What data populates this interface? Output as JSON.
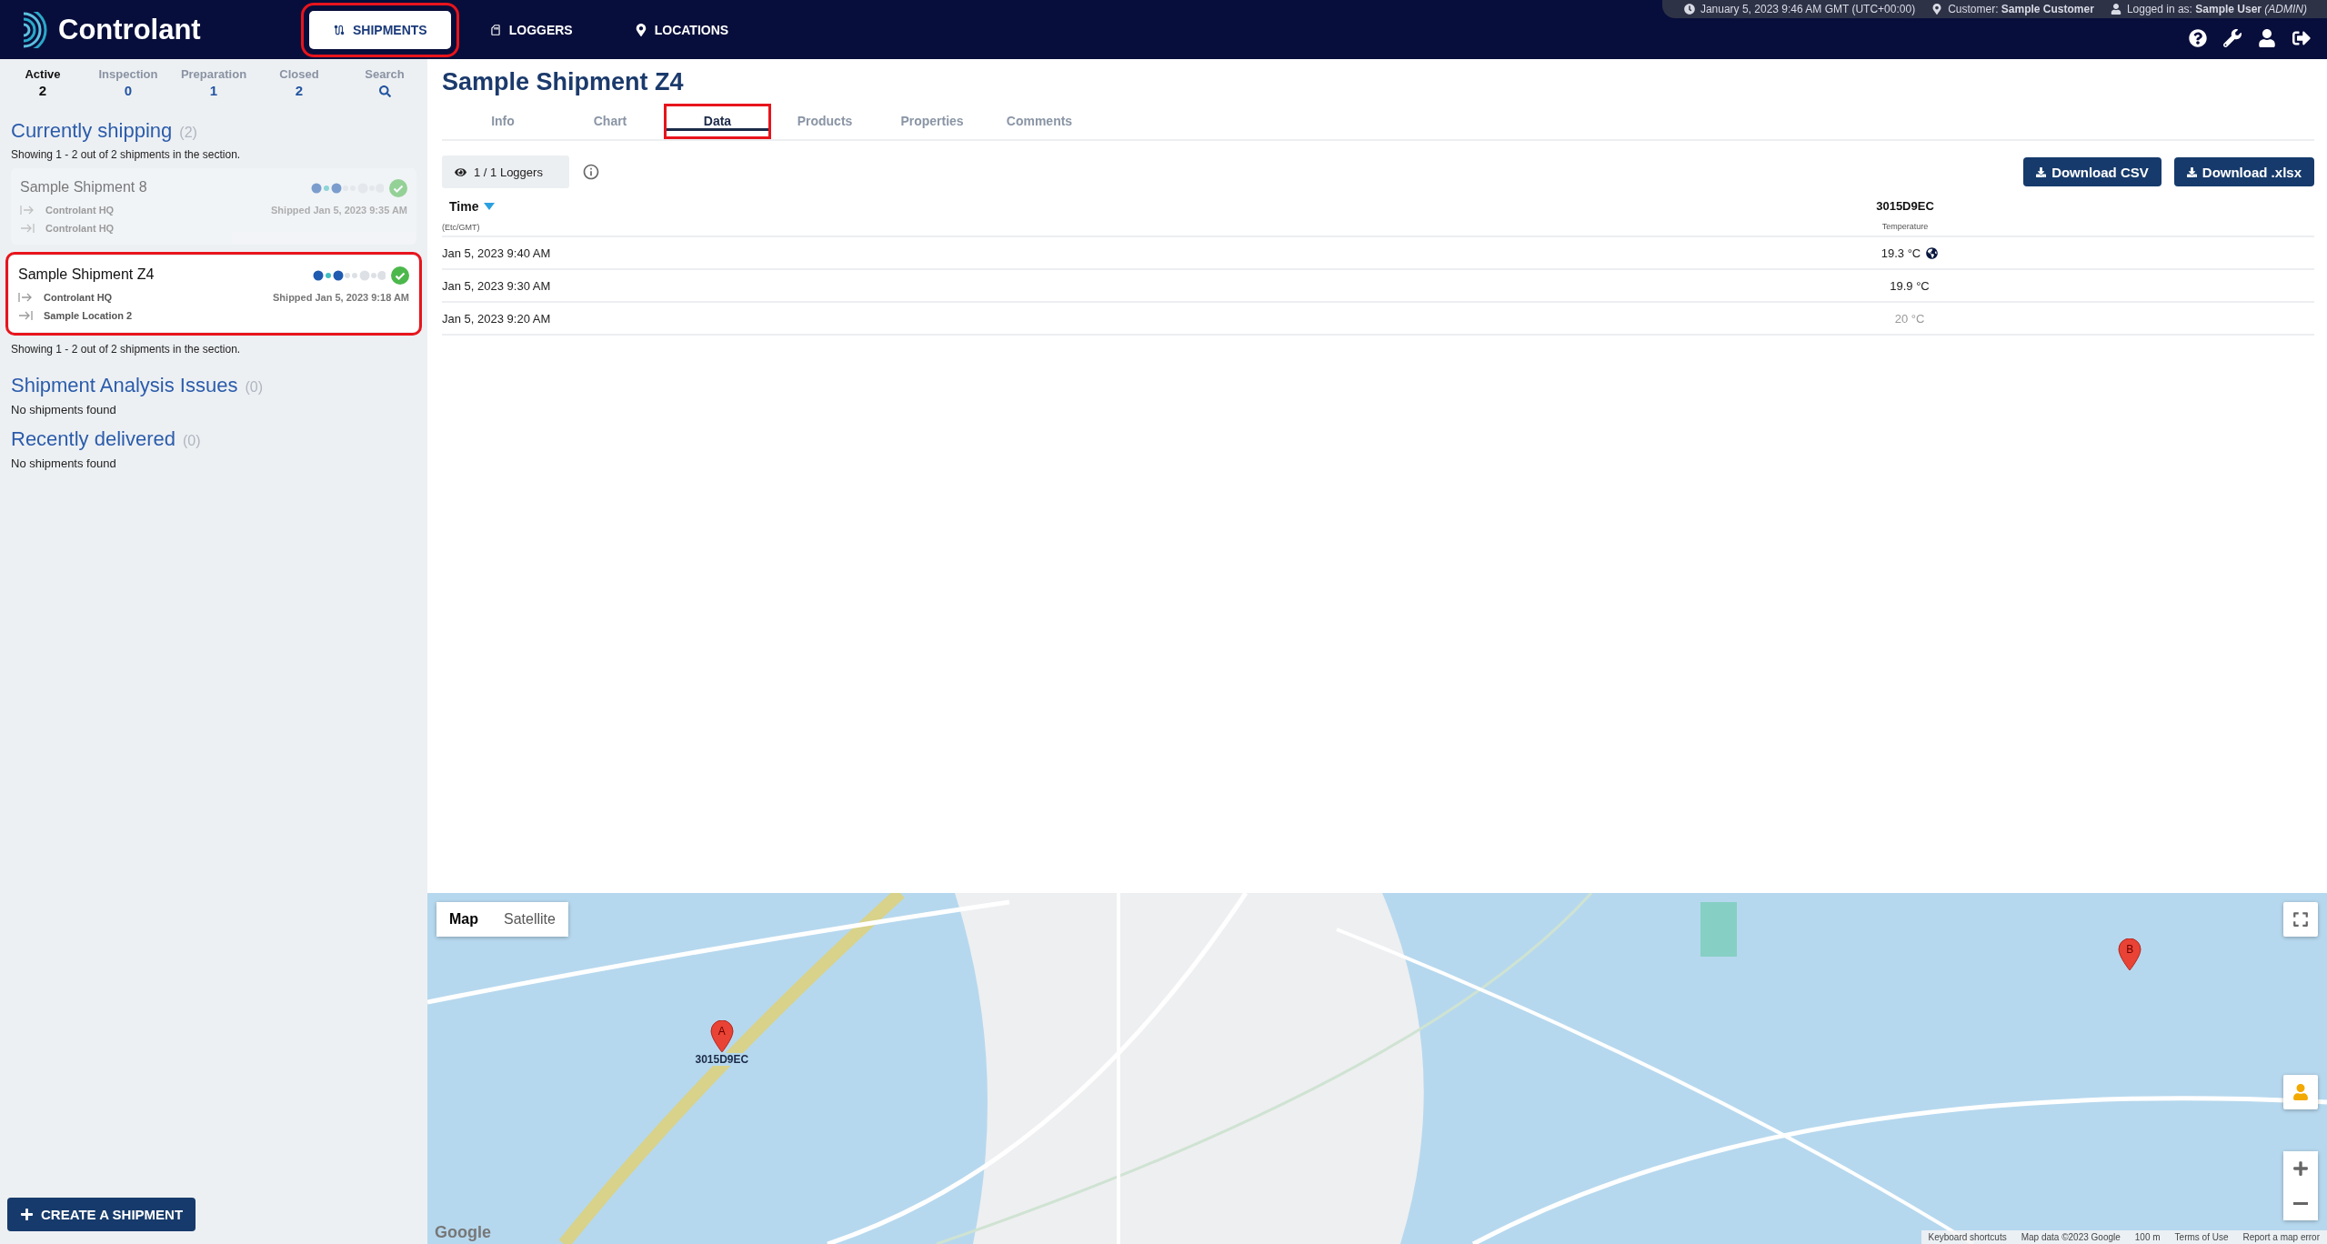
{
  "brand": {
    "name": "Controlant"
  },
  "nav": [
    {
      "label": "SHIPMENTS",
      "kind": "route",
      "selected": true
    },
    {
      "label": "LOGGERS",
      "kind": "logger",
      "selected": false
    },
    {
      "label": "LOCATIONS",
      "kind": "pin",
      "selected": false
    }
  ],
  "info_bar": {
    "datetime": "January 5, 2023 9:46 AM GMT (UTC+00:00)",
    "customer": "Customer: **Sample Customer**",
    "login": "Logged in as: **Sample User** *(ADMIN)*"
  },
  "status_tabs": [
    {
      "kind": "count",
      "label": "Active",
      "count": "2",
      "selected": true
    },
    {
      "kind": "count",
      "label": "Inspection",
      "count": "0",
      "selected": false
    },
    {
      "kind": "count",
      "label": "Preparation",
      "count": "1",
      "selected": false
    },
    {
      "kind": "count",
      "label": "Closed",
      "count": "2",
      "selected": false
    },
    {
      "kind": "search",
      "label": "Search",
      "selected": false
    }
  ],
  "sections": [
    {
      "title": "Currently shipping",
      "count": "(2)",
      "summary": "Showing 1 - 2 out of 2 shipments in the section.",
      "shipments": [
        {
          "name": "Sample Shipment 8",
          "origin": "Controlant HQ",
          "destination": "Controlant HQ",
          "shipped": "Shipped Jan 5, 2023 9:35 AM",
          "selected": false
        },
        {
          "name": "Sample Shipment Z4",
          "origin": "Controlant HQ",
          "destination": "Sample Location 2",
          "shipped": "Shipped Jan 5, 2023 9:18 AM",
          "selected": true
        }
      ],
      "footer": "Showing 1 - 2 out of 2 shipments in the section."
    },
    {
      "title": "Shipment Analysis Issues",
      "count": "(0)",
      "empty": "No shipments found"
    },
    {
      "title": "Recently delivered",
      "count": "(0)",
      "empty": "No shipments found"
    }
  ],
  "create_button": "CREATE A SHIPMENT",
  "detail": {
    "title": "Sample Shipment Z4",
    "tabs": [
      {
        "label": "Info",
        "selected": false
      },
      {
        "label": "Chart",
        "selected": false
      },
      {
        "label": "Data",
        "selected": true
      },
      {
        "label": "Products",
        "selected": false
      },
      {
        "label": "Properties",
        "selected": false
      },
      {
        "label": "Comments",
        "selected": false
      }
    ],
    "loggers_toggle": "1 / 1 Loggers",
    "downloads": [
      "Download CSV",
      "Download .xlsx"
    ],
    "table": {
      "columns": [
        {
          "title": "Time",
          "subtitle": "(Etc/GMT)",
          "sorted": true
        },
        {
          "title": "3015D9EC",
          "subtitle": "Temperature"
        }
      ],
      "rows": [
        {
          "time": "Jan 5, 2023 9:40 AM",
          "value": "19.3 °C",
          "located": true,
          "muted": false
        },
        {
          "time": "Jan 5, 2023 9:30 AM",
          "value": "19.9 °C",
          "located": false,
          "muted": false
        },
        {
          "time": "Jan 5, 2023 9:20 AM",
          "value": "20 °C",
          "located": false,
          "muted": true
        }
      ]
    }
  },
  "map": {
    "types": [
      {
        "label": "Map",
        "selected": true
      },
      {
        "label": "Satellite",
        "selected": false
      }
    ],
    "markers": [
      {
        "letter": "A",
        "label": "3015D9EC"
      },
      {
        "letter": "B"
      }
    ],
    "logo": "Google",
    "footer": [
      "Keyboard shortcuts",
      "Map data ©2023 Google",
      "100 m",
      "Terms of Use",
      "Report a map error"
    ]
  }
}
